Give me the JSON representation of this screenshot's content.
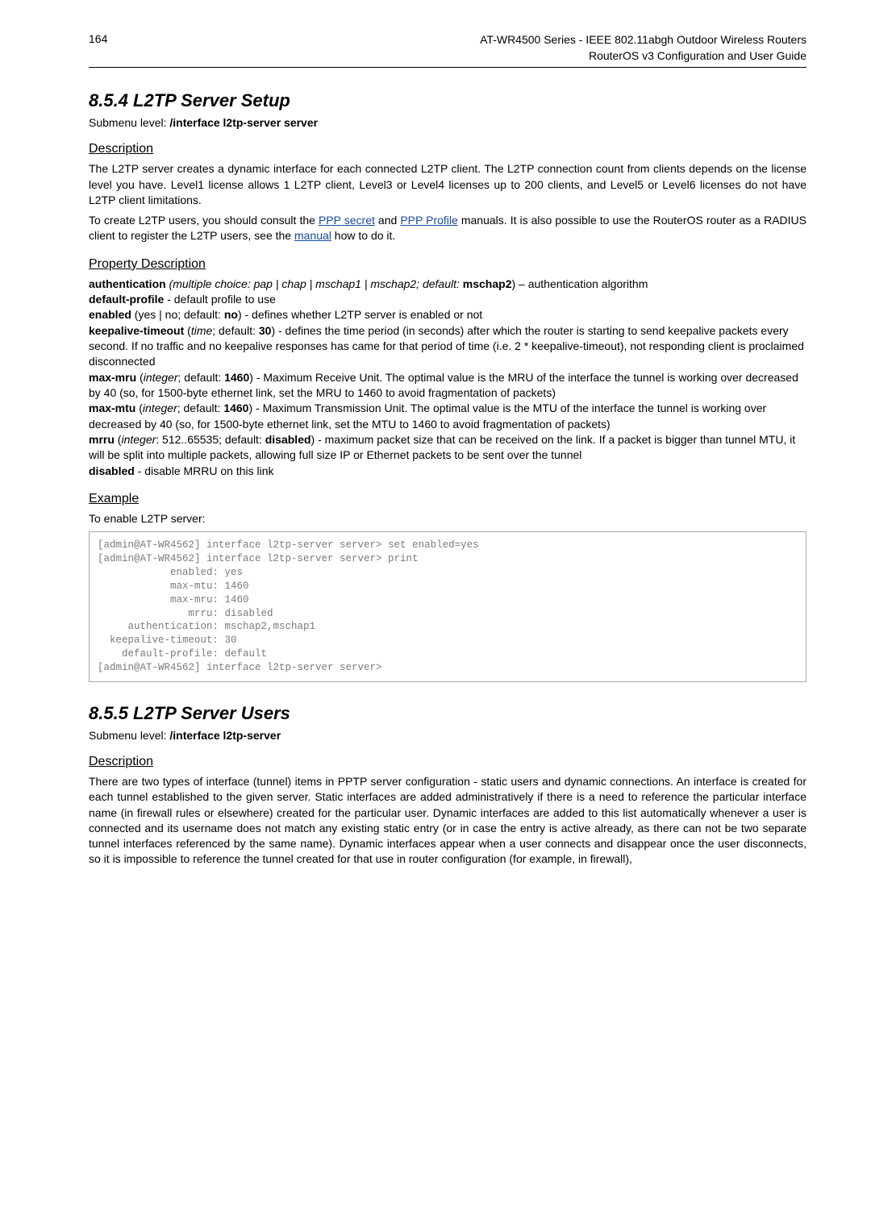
{
  "header": {
    "page_number": "164",
    "line1": "AT-WR4500 Series - IEEE 802.11abgh Outdoor Wireless Routers",
    "line2": "RouterOS v3 Configuration and User Guide"
  },
  "section854": {
    "title": "8.5.4  L2TP Server Setup",
    "submenu_prefix": "Submenu level: ",
    "submenu_value": "/interface l2tp-server server",
    "description_heading": "Description",
    "description_p1_a": "The L2TP server creates a dynamic interface for each connected L2TP client. The L2TP connection count from clients depends on the license level you have. Level1 license allows 1 L2TP client, Level3 or Level4 licenses up to 200 clients, and Level5 or Level6 licenses do not have L2TP client limitations.",
    "description_p2_a": "To create L2TP users, you should consult the ",
    "link_ppp_secret": "PPP secret",
    "description_p2_b": " and ",
    "link_ppp_profile": "PPP Profile",
    "description_p2_c": " manuals. It is also possible to use the RouterOS router as a RADIUS client to register the L2TP users, see the ",
    "link_manual": "manual",
    "description_p2_d": " how to do it.",
    "property_heading": "Property Description",
    "prop": {
      "auth_label": "authentication",
      "auth_desc": " (multiple choice: pap | chap | mschap1 | mschap2; default: ",
      "auth_default": "mschap2",
      "auth_tail": ") – authentication algorithm",
      "default_profile_label": "default-profile",
      "default_profile_desc": " - default profile to use",
      "enabled_label": "enabled",
      "enabled_desc_a": " (yes | no; default: ",
      "enabled_default": "no",
      "enabled_desc_b": ") - defines whether L2TP server is enabled or not",
      "keepalive_label": "keepalive-timeout",
      "keepalive_desc_a": " (time; default: ",
      "keepalive_default": "30",
      "keepalive_desc_b": ") - defines the time period (in seconds) after which the router is starting to send keepalive packets every second. If no traffic and no keepalive responses has came for that period of time (i.e. 2 * keepalive-timeout), not responding client is proclaimed disconnected",
      "maxmru_label": "max-mru",
      "maxmru_desc_a": " (integer; default: ",
      "maxmru_default": "1460",
      "maxmru_desc_b": ") - Maximum Receive Unit. The optimal value is the MRU of the interface the tunnel is working over decreased by 40 (so, for 1500-byte ethernet link, set the MRU to 1460 to avoid fragmentation of packets)",
      "maxmtu_label": "max-mtu",
      "maxmtu_desc_a": " (integer; default: ",
      "maxmtu_default": "1460",
      "maxmtu_desc_b": ") - Maximum Transmission Unit. The optimal value is the MTU of the interface the tunnel is working over decreased by 40 (so, for 1500-byte ethernet link, set the MTU to 1460 to avoid fragmentation of packets)",
      "mrru_label": "mrru",
      "mrru_desc_a": " (integer: 512..65535; default: ",
      "mrru_default": "disabled",
      "mrru_desc_b": ") - maximum packet size that can be received on the link. If a packet is bigger than tunnel MTU, it will be split into multiple packets, allowing full size IP or Ethernet packets to be sent over the tunnel",
      "disabled_label": "disabled",
      "disabled_desc": " - disable MRRU on this link"
    },
    "example_heading": "Example",
    "example_intro": "To enable L2TP server:",
    "code": "[admin@AT-WR4562] interface l2tp-server server> set enabled=yes\n[admin@AT-WR4562] interface l2tp-server server> print\n            enabled: yes\n            max-mtu: 1460\n            max-mru: 1460\n               mrru: disabled\n     authentication: mschap2,mschap1\n  keepalive-timeout: 30\n    default-profile: default\n[admin@AT-WR4562] interface l2tp-server server>"
  },
  "section855": {
    "title": "8.5.5  L2TP Server Users",
    "submenu_prefix": "Submenu level: ",
    "submenu_value": "/interface l2tp-server",
    "description_heading": "Description",
    "description_p1": "There are two types of interface (tunnel) items in PPTP server configuration - static users and dynamic connections. An interface is created for each tunnel established to the given server. Static interfaces are added administratively if there is a need to reference the particular interface name (in firewall rules or elsewhere) created for the particular user. Dynamic interfaces are added to this list automatically whenever a user is connected and its username does not match any existing static entry (or in case the entry is active already, as there can not be two separate tunnel interfaces referenced by the same name). Dynamic interfaces appear when a user connects and disappear once the user disconnects, so it is impossible to reference the tunnel created for that use in router configuration (for example, in firewall),"
  }
}
